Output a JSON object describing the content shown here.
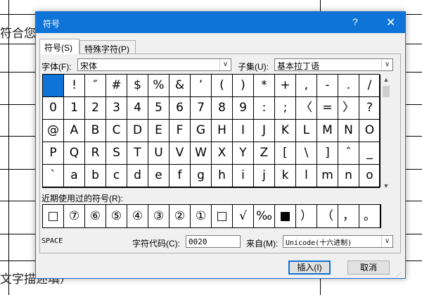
{
  "document": {
    "text_top": "符合您",
    "text_bottom": "文字描述填）"
  },
  "dialog": {
    "title": "符号",
    "help_label": "?",
    "close_label": "✕",
    "tabs": [
      {
        "label": "符号(S)"
      },
      {
        "label": "特殊字符(P)"
      }
    ],
    "font_label": "字体(F):",
    "font_value": "宋体",
    "subset_label": "子集(U):",
    "subset_value": "基本拉丁语",
    "symbols": [
      [
        " ",
        "!",
        "″",
        "#",
        "$",
        "%",
        "&",
        "’",
        "(",
        ")",
        "*",
        "+",
        ",",
        "-",
        ".",
        "/"
      ],
      [
        "0",
        "1",
        "2",
        "3",
        "4",
        "5",
        "6",
        "7",
        "8",
        "9",
        ":",
        ";",
        "〈",
        "=",
        "〉",
        "?"
      ],
      [
        "@",
        "A",
        "B",
        "C",
        "D",
        "E",
        "F",
        "G",
        "H",
        "I",
        "J",
        "K",
        "L",
        "M",
        "N",
        "O"
      ],
      [
        "P",
        "Q",
        "R",
        "S",
        "T",
        "U",
        "V",
        "W",
        "X",
        "Y",
        "Z",
        "[",
        "\\",
        "]",
        "ˆ",
        "_"
      ],
      [
        "ˋ",
        "a",
        "b",
        "c",
        "d",
        "e",
        "f",
        "g",
        "h",
        "i",
        "j",
        "k",
        "l",
        "m",
        "n",
        "o"
      ]
    ],
    "selected_symbol_index": 0,
    "recent_label": "近期使用过的符号(R):",
    "recent_symbols": [
      "□",
      "⑦",
      "⑥",
      "⑤",
      "④",
      "③",
      "②",
      "①",
      "□",
      "√",
      "‰",
      "■",
      "）",
      "（",
      "，",
      "。"
    ],
    "char_name": "SPACE",
    "char_code_label": "字符代码(C):",
    "char_code_value": "0020",
    "from_label": "来自(M):",
    "from_value": "Unicode(十六进制)",
    "insert_label": "插入(I)",
    "cancel_label": "取消",
    "scroll_up_icon": "▲",
    "scroll_down_icon": "▼",
    "dropdown_icon": "∨"
  },
  "colors": {
    "titlebar": "#0e74d8",
    "selection": "#0e74d8",
    "dialog_bg": "#f0f0f0"
  }
}
